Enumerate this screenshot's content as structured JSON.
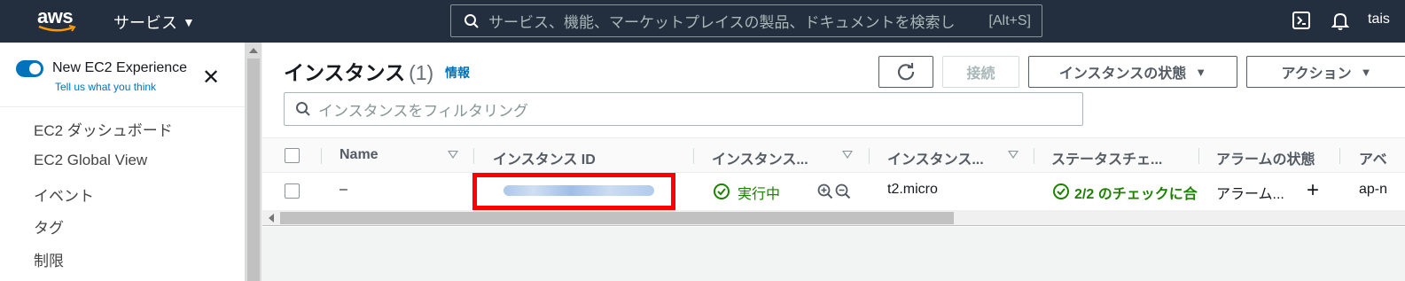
{
  "topbar": {
    "logo_text": "aws",
    "services_label": "サービス",
    "search_placeholder": "サービス、機能、マーケットプレイスの製品、ドキュメントを検索し",
    "search_shortcut": "[Alt+S]",
    "user_partial": "tais",
    "icons": [
      "cloudshell-icon",
      "bell-icon"
    ]
  },
  "sidebar": {
    "new_experience_label": "New EC2 Experience",
    "new_experience_enabled": true,
    "tell_us_link": "Tell us what you think",
    "items": [
      {
        "label": "EC2 ダッシュボード"
      },
      {
        "label": "EC2 Global View"
      },
      {
        "label": "イベント"
      },
      {
        "label": "タグ"
      },
      {
        "label": "制限"
      }
    ]
  },
  "main": {
    "title": "インスタンス",
    "count": "(1)",
    "info_link": "情報",
    "buttons": {
      "refresh_icon": "refresh-icon",
      "connect": "接続",
      "instance_state": "インスタンスの状態",
      "actions": "アクション"
    },
    "filter_placeholder": "インスタンスをフィルタリング",
    "table": {
      "headers": [
        "Name",
        "インスタンス ID",
        "インスタンス...",
        "インスタンス...",
        "ステータスチェ...",
        "アラームの状態",
        "アベ"
      ],
      "rows": [
        {
          "name": "–",
          "instance_state": "実行中",
          "instance_type": "t2.micro",
          "status_check": "2/2 のチェックに合",
          "alarm_state": "アラーム...",
          "az": "ap-n"
        }
      ]
    }
  },
  "colors": {
    "topbar_bg": "#232f3e",
    "link": "#0073bb",
    "success": "#1d8102",
    "highlight": "#ff0000"
  }
}
